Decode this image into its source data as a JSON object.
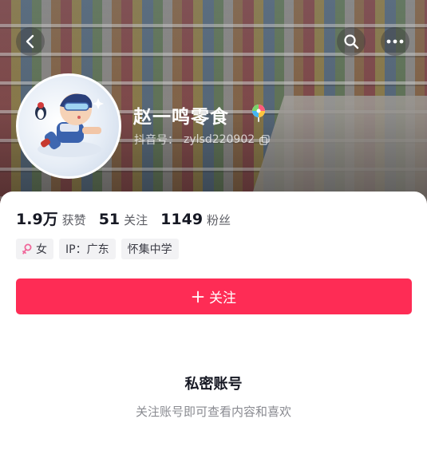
{
  "header": {
    "display_name": "赵一鸣零食",
    "handle_label": "抖音号：",
    "handle_value": "zylsd220902"
  },
  "icons": {
    "back": "back-arrow-icon",
    "search": "search-icon",
    "more": "more-icon",
    "name_emoji": "lollipop-icon",
    "copy": "copy-icon",
    "gender": "female-icon",
    "follow": "plus-icon"
  },
  "stats": [
    {
      "value": "1.9万",
      "label": "获赞"
    },
    {
      "value": "51",
      "label": "关注"
    },
    {
      "value": "1149",
      "label": "粉丝"
    }
  ],
  "tags": {
    "gender": "女",
    "ip": "IP：广东",
    "school": "怀集中学"
  },
  "follow_button": {
    "label": "关注"
  },
  "private_notice": {
    "title": "私密账号",
    "description": "关注账号即可查看内容和喜欢"
  },
  "colors": {
    "accent": "#fe2c55",
    "text_primary": "#161823",
    "text_secondary": "#8a8b91",
    "tag_bg": "#f2f2f4",
    "gender_icon": "#f0679a"
  }
}
